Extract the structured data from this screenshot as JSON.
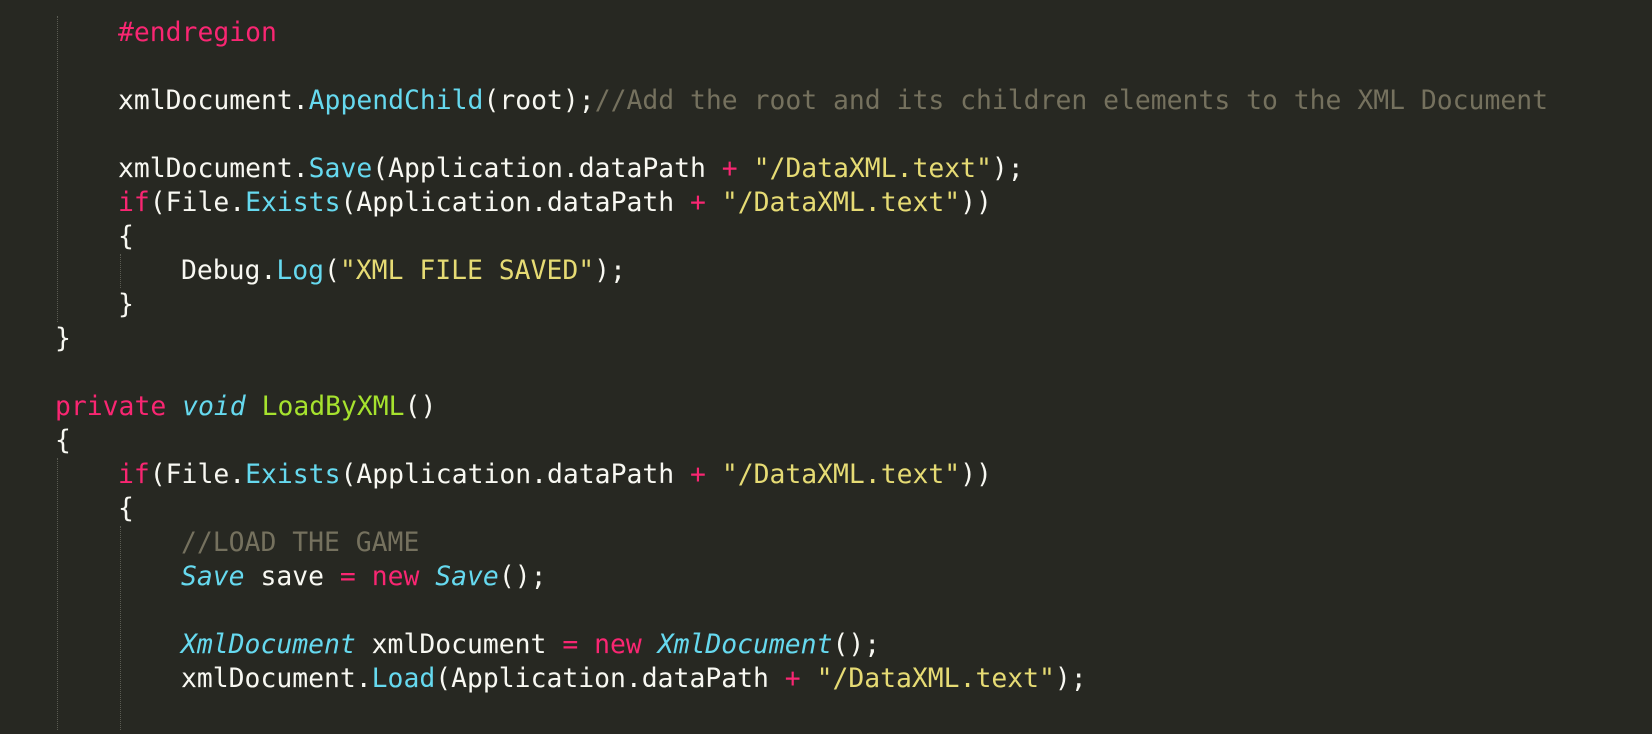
{
  "theme": {
    "background": "#272822",
    "foreground": "#f8f8f2",
    "keyword": "#f92672",
    "string": "#e6db74",
    "comment": "#75715e",
    "function_call": "#66d9ef",
    "definition": "#a6e22e",
    "type": "#66d9ef"
  },
  "lines": [
    {
      "indent": 1,
      "tokens": [
        {
          "t": "#endregion",
          "c": "kw"
        }
      ]
    },
    {
      "indent": 0,
      "tokens": []
    },
    {
      "indent": 1,
      "tokens": [
        {
          "t": "xmlDocument.",
          "c": "pl"
        },
        {
          "t": "AppendChild",
          "c": "fn"
        },
        {
          "t": "(root);",
          "c": "pl"
        },
        {
          "t": "//Add the root and its children elements to the XML Document",
          "c": "cm"
        }
      ]
    },
    {
      "indent": 0,
      "tokens": []
    },
    {
      "indent": 1,
      "tokens": [
        {
          "t": "xmlDocument.",
          "c": "pl"
        },
        {
          "t": "Save",
          "c": "fn"
        },
        {
          "t": "(Application.dataPath ",
          "c": "pl"
        },
        {
          "t": "+",
          "c": "kw"
        },
        {
          "t": " ",
          "c": "pl"
        },
        {
          "t": "\"/DataXML.text\"",
          "c": "str"
        },
        {
          "t": ");",
          "c": "pl"
        }
      ]
    },
    {
      "indent": 1,
      "tokens": [
        {
          "t": "if",
          "c": "kw"
        },
        {
          "t": "(File.",
          "c": "pl"
        },
        {
          "t": "Exists",
          "c": "fn"
        },
        {
          "t": "(Application.dataPath ",
          "c": "pl"
        },
        {
          "t": "+",
          "c": "kw"
        },
        {
          "t": " ",
          "c": "pl"
        },
        {
          "t": "\"/DataXML.text\"",
          "c": "str"
        },
        {
          "t": "))",
          "c": "pl"
        }
      ]
    },
    {
      "indent": 1,
      "tokens": [
        {
          "t": "{",
          "c": "pl"
        }
      ]
    },
    {
      "indent": 2,
      "tokens": [
        {
          "t": "Debug.",
          "c": "pl"
        },
        {
          "t": "Log",
          "c": "fn"
        },
        {
          "t": "(",
          "c": "pl"
        },
        {
          "t": "\"XML FILE SAVED\"",
          "c": "str"
        },
        {
          "t": ");",
          "c": "pl"
        }
      ]
    },
    {
      "indent": 1,
      "tokens": [
        {
          "t": "}",
          "c": "pl"
        }
      ]
    },
    {
      "indent": 0,
      "tokens": [
        {
          "t": "}",
          "c": "pl"
        }
      ]
    },
    {
      "indent": 0,
      "tokens": []
    },
    {
      "indent": 0,
      "tokens": [
        {
          "t": "private",
          "c": "kw"
        },
        {
          "t": " ",
          "c": "pl"
        },
        {
          "t": "void",
          "c": "it"
        },
        {
          "t": " ",
          "c": "pl"
        },
        {
          "t": "LoadByXML",
          "c": "def"
        },
        {
          "t": "()",
          "c": "pl"
        }
      ]
    },
    {
      "indent": 0,
      "tokens": [
        {
          "t": "{",
          "c": "pl"
        }
      ]
    },
    {
      "indent": 1,
      "tokens": [
        {
          "t": "if",
          "c": "kw"
        },
        {
          "t": "(File.",
          "c": "pl"
        },
        {
          "t": "Exists",
          "c": "fn"
        },
        {
          "t": "(Application.dataPath ",
          "c": "pl"
        },
        {
          "t": "+",
          "c": "kw"
        },
        {
          "t": " ",
          "c": "pl"
        },
        {
          "t": "\"/DataXML.text\"",
          "c": "str"
        },
        {
          "t": "))",
          "c": "pl"
        }
      ]
    },
    {
      "indent": 1,
      "tokens": [
        {
          "t": "{",
          "c": "pl"
        }
      ]
    },
    {
      "indent": 2,
      "tokens": [
        {
          "t": "//LOAD THE GAME",
          "c": "cm"
        }
      ]
    },
    {
      "indent": 2,
      "tokens": [
        {
          "t": "Save",
          "c": "it"
        },
        {
          "t": " save ",
          "c": "pl"
        },
        {
          "t": "=",
          "c": "kw"
        },
        {
          "t": " ",
          "c": "pl"
        },
        {
          "t": "new",
          "c": "kw"
        },
        {
          "t": " ",
          "c": "pl"
        },
        {
          "t": "Save",
          "c": "it"
        },
        {
          "t": "();",
          "c": "pl"
        }
      ]
    },
    {
      "indent": 0,
      "tokens": []
    },
    {
      "indent": 2,
      "tokens": [
        {
          "t": "XmlDocument",
          "c": "it"
        },
        {
          "t": " xmlDocument ",
          "c": "pl"
        },
        {
          "t": "=",
          "c": "kw"
        },
        {
          "t": " ",
          "c": "pl"
        },
        {
          "t": "new",
          "c": "kw"
        },
        {
          "t": " ",
          "c": "pl"
        },
        {
          "t": "XmlDocument",
          "c": "it"
        },
        {
          "t": "();",
          "c": "pl"
        }
      ]
    },
    {
      "indent": 2,
      "tokens": [
        {
          "t": "xmlDocument.",
          "c": "pl"
        },
        {
          "t": "Load",
          "c": "fn"
        },
        {
          "t": "(Application.dataPath ",
          "c": "pl"
        },
        {
          "t": "+",
          "c": "kw"
        },
        {
          "t": " ",
          "c": "pl"
        },
        {
          "t": "\"/DataXML.text\"",
          "c": "str"
        },
        {
          "t": ");",
          "c": "pl"
        }
      ]
    },
    {
      "indent": 0,
      "tokens": []
    }
  ]
}
